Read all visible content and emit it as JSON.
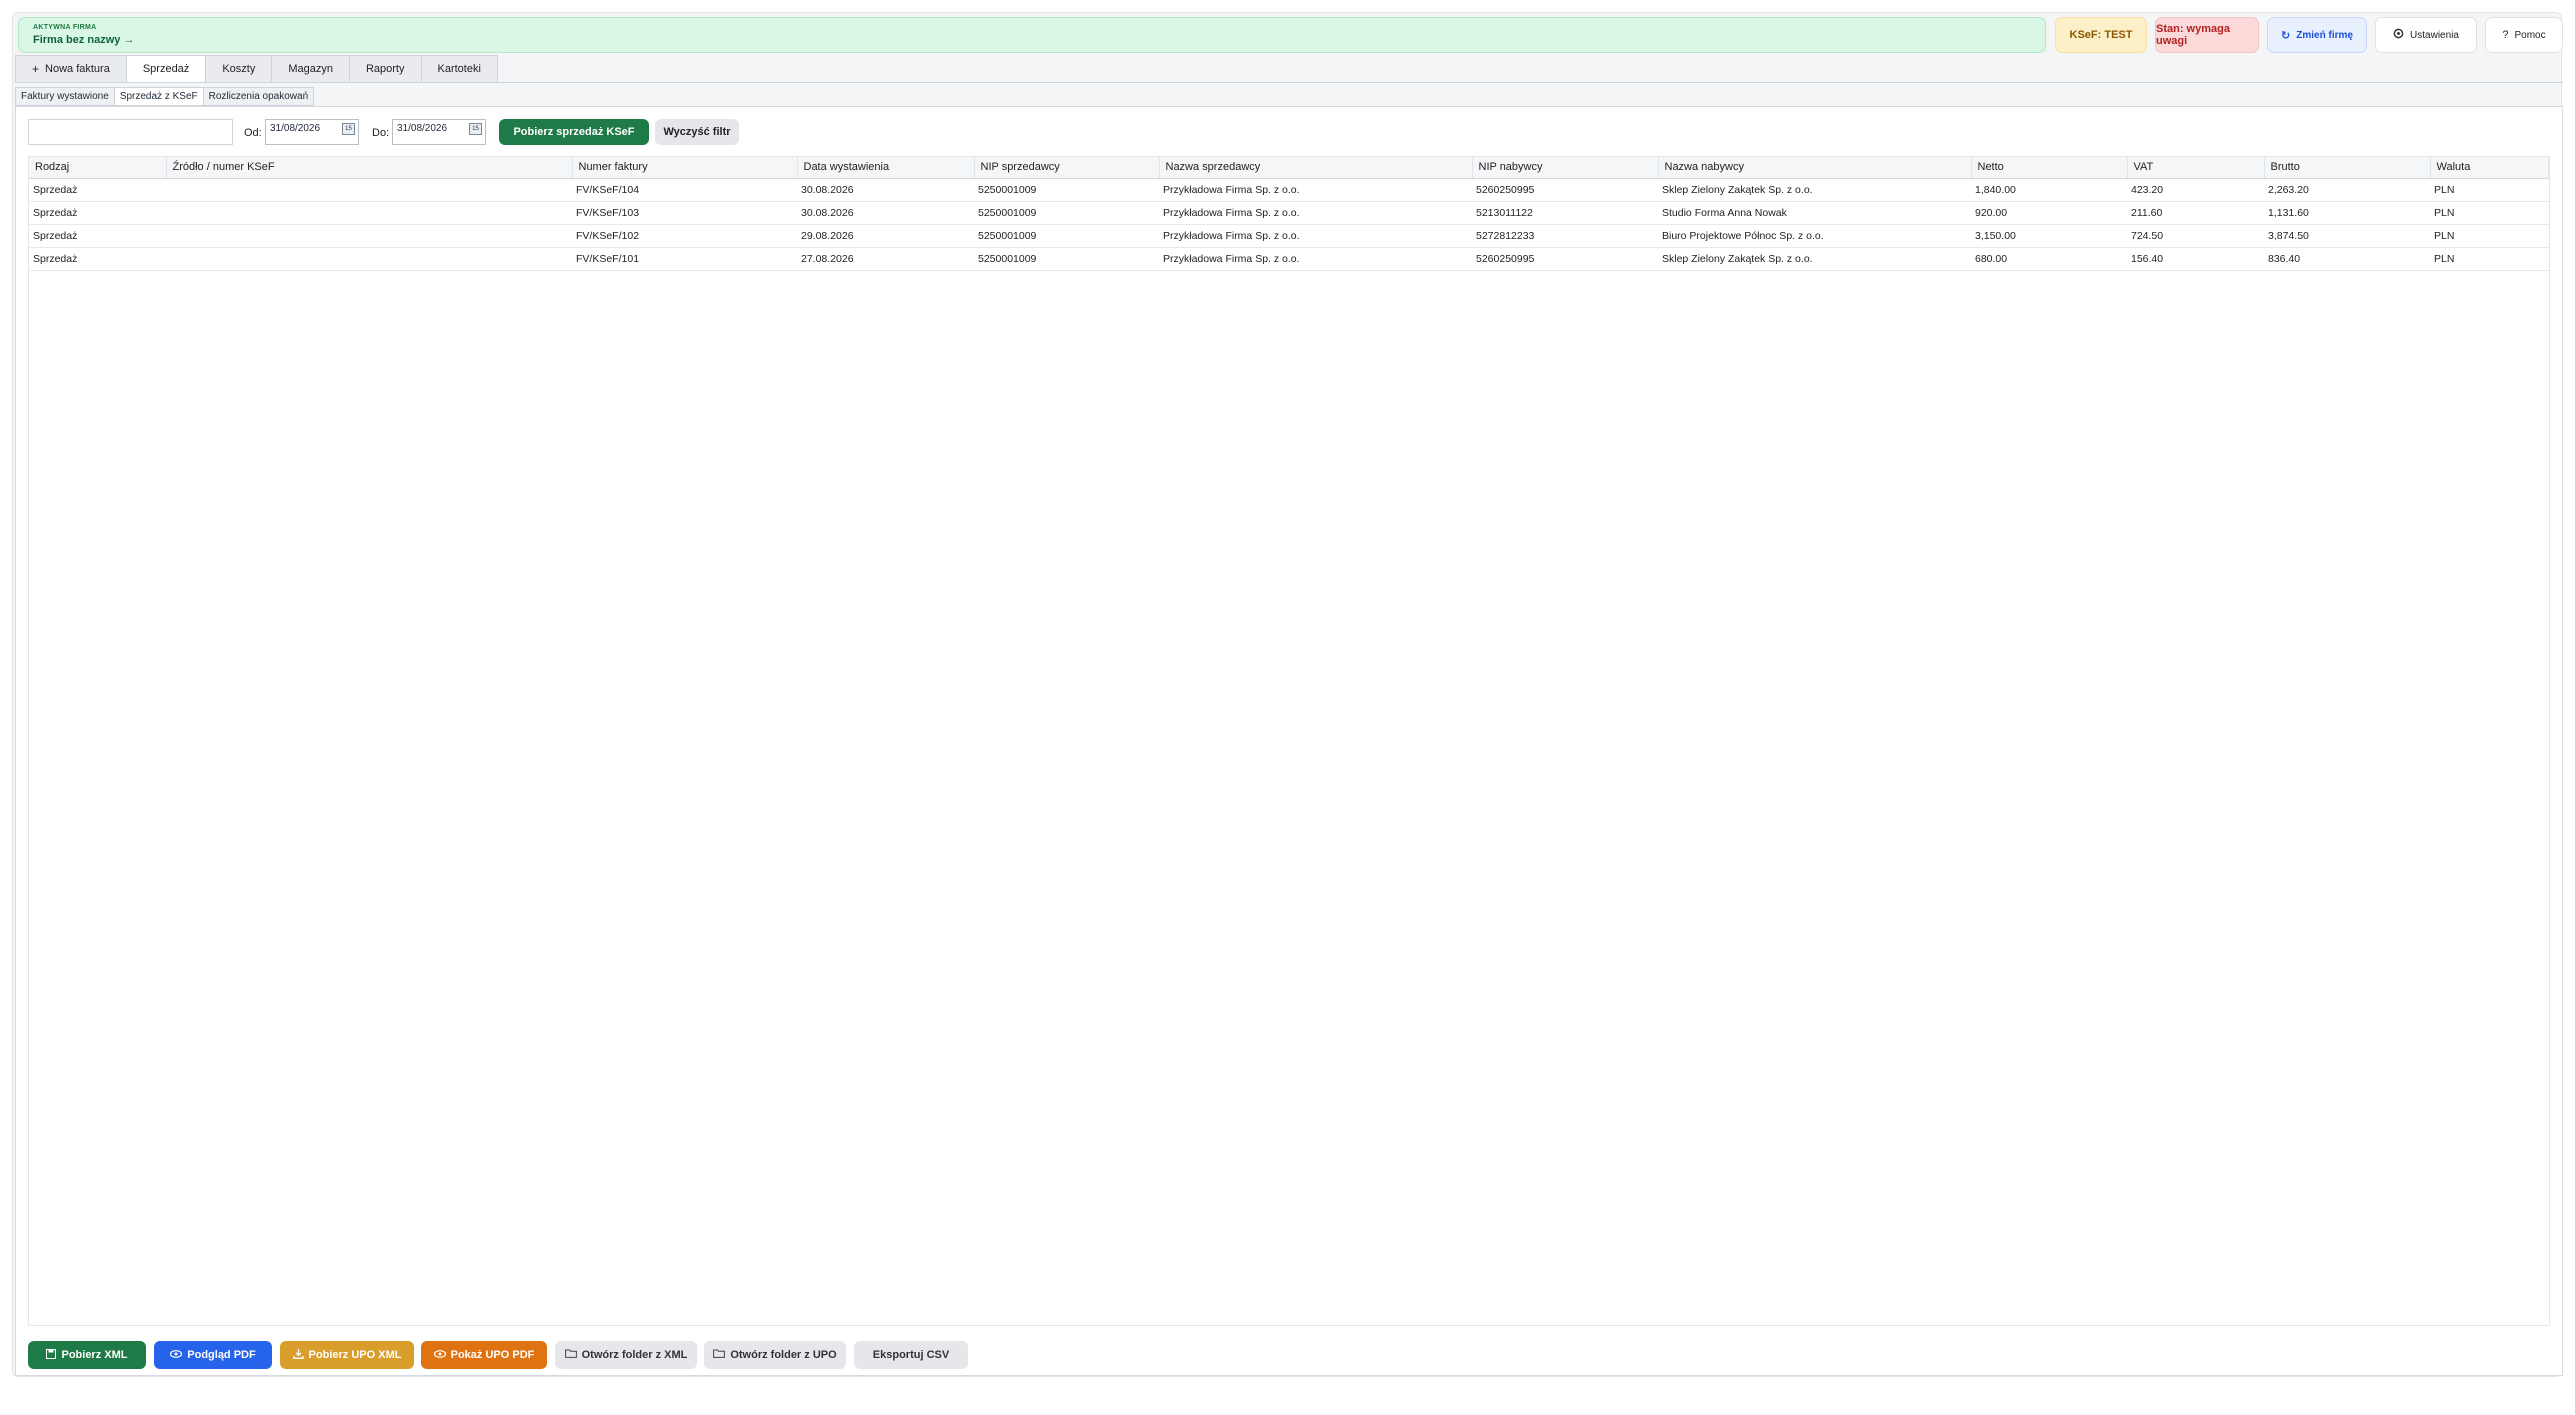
{
  "company": {
    "label": "AKTYWNA FIRMA",
    "name": "Firma bez nazwy →"
  },
  "status": {
    "ksef": "KSeF: TEST",
    "stan": "Stan: wymaga uwagi",
    "change_company": "Zmień firmę",
    "settings": "Ustawienia",
    "help": "Pomoc"
  },
  "icons": {
    "change_company": "refresh-icon",
    "settings": "gear-icon",
    "help": "question-icon",
    "new_invoice": "plus-icon",
    "calendar": "calendar-icon",
    "save": "floppy-icon",
    "eye": "eye-icon",
    "download": "download-icon",
    "folder": "folder-icon"
  },
  "tabs": [
    {
      "label": "Nowa faktura"
    },
    {
      "label": "Sprzedaż"
    },
    {
      "label": "Koszty"
    },
    {
      "label": "Magazyn"
    },
    {
      "label": "Raporty"
    },
    {
      "label": "Kartoteki"
    }
  ],
  "subtabs": [
    {
      "label": "Faktury wystawione"
    },
    {
      "label": "Sprzedaż z KSeF"
    },
    {
      "label": "Rozliczenia opakowań"
    }
  ],
  "filter": {
    "search_value": "",
    "from_label": "Od:",
    "from_value": "31/08/2026",
    "to_label": "Do:",
    "to_value": "31/08/2026",
    "fetch_label": "Pobierz sprzedaż KSeF",
    "clear_label": "Wyczyść filtr"
  },
  "table": {
    "columns": [
      "Rodzaj",
      "Źródło / numer KSeF",
      "Numer faktury",
      "Data wystawienia",
      "NIP sprzedawcy",
      "Nazwa sprzedawcy",
      "NIP nabywcy",
      "Nazwa nabywcy",
      "Netto",
      "VAT",
      "Brutto",
      "Waluta"
    ],
    "rows": [
      [
        "Sprzedaż",
        "",
        "FV/KSeF/104",
        "30.08.2026",
        "5250001009",
        "Przykładowa Firma Sp. z o.o.",
        "5260250995",
        "Sklep Zielony Zakątek Sp. z o.o.",
        "1,840.00",
        "423.20",
        "2,263.20",
        "PLN"
      ],
      [
        "Sprzedaż",
        "",
        "FV/KSeF/103",
        "30.08.2026",
        "5250001009",
        "Przykładowa Firma Sp. z o.o.",
        "5213011122",
        "Studio Forma Anna Nowak",
        "920.00",
        "211.60",
        "1,131.60",
        "PLN"
      ],
      [
        "Sprzedaż",
        "",
        "FV/KSeF/102",
        "29.08.2026",
        "5250001009",
        "Przykładowa Firma Sp. z o.o.",
        "5272812233",
        "Biuro Projektowe Północ Sp. z o.o.",
        "3,150.00",
        "724.50",
        "3,874.50",
        "PLN"
      ],
      [
        "Sprzedaż",
        "",
        "FV/KSeF/101",
        "27.08.2026",
        "5250001009",
        "Przykładowa Firma Sp. z o.o.",
        "5260250995",
        "Sklep Zielony Zakątek Sp. z o.o.",
        "680.00",
        "156.40",
        "836.40",
        "PLN"
      ]
    ]
  },
  "actions": {
    "download_xml": "Pobierz XML",
    "preview_pdf": "Podgląd PDF",
    "download_upo_xml": "Pobierz UPO XML",
    "show_upo_pdf": "Pokaż UPO PDF",
    "open_folder_xml": "Otwórz folder z XML",
    "open_folder_upo": "Otwórz folder z UPO",
    "export_csv": "Eksportuj CSV"
  }
}
